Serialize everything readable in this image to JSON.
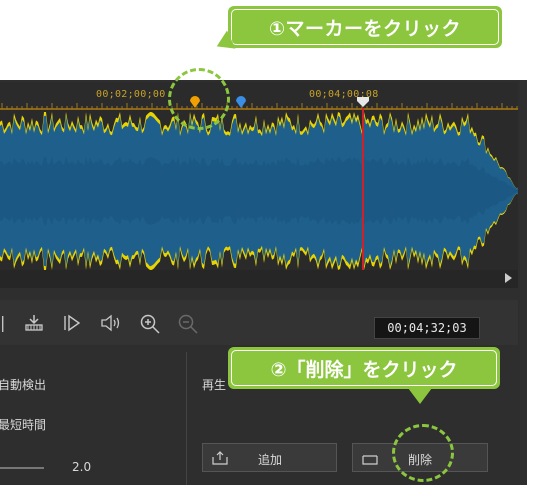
{
  "callouts": {
    "step1": "①マーカーをクリック",
    "step2": "②「削除」をクリック"
  },
  "timeline": {
    "labels": [
      "00;02;00;00",
      "00;04;00;08"
    ]
  },
  "transport": {
    "timecode": "00;04;32;03"
  },
  "settings": {
    "auto_detect_label": "自動検出",
    "min_duration_label": "最短時間",
    "slider_value": "2.0"
  },
  "marker_panel": {
    "playback_label": "再生",
    "add_label": "追加",
    "delete_label": "削除"
  },
  "colors": {
    "accent_green": "#8cc63f",
    "wave_blue": "#1f5f8b",
    "peak_yellow": "#e8d400",
    "marker_orange": "#f0a000",
    "marker_blue": "#3a8ee6",
    "playhead_red": "#d0202a"
  },
  "icons": [
    "marker-orange-icon",
    "marker-blue-icon",
    "playhead-icon",
    "split-icon",
    "play-icon",
    "volume-icon",
    "zoom-in-icon",
    "zoom-out-icon",
    "add-icon",
    "delete-icon"
  ]
}
